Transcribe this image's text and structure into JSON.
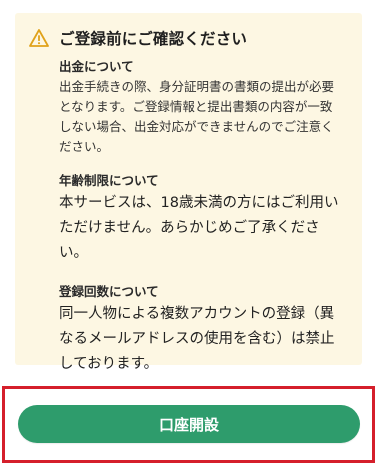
{
  "notice": {
    "icon": "warning-icon",
    "title": "ご登録前にご確認ください",
    "sections": [
      {
        "heading": "出金について",
        "body": "出金手続きの際、身分証明書の書類の提出が必要\nとなります。ご登録情報と提出書類の内容が一致\nしない場合、出金対応ができませんのでご注意く\nださい。"
      },
      {
        "heading": "年齢制限について",
        "body": "本サービスは、18歳未満の方にはご利用い\nただけません。あらかじめご了承くださ\nい。"
      },
      {
        "heading": "登録回数について",
        "body": "同一人物による複数アカウントの登録（異\nなるメールアドレスの使用を含む）は禁止\nしております。"
      }
    ]
  },
  "cta": {
    "label": "口座開設"
  },
  "colors": {
    "notice_bg": "#fdf7e3",
    "warning": "#e0a21a",
    "button": "#2e9c6c",
    "highlight_frame": "#d51f2b"
  }
}
